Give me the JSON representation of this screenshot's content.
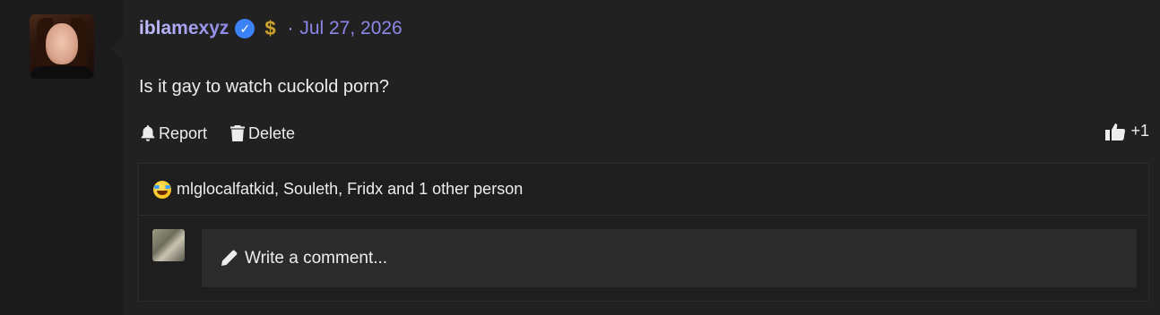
{
  "author": {
    "username": "iblamexyz",
    "badge_symbol": "$",
    "separator": "·",
    "date": "Jul 27, 2026"
  },
  "post": {
    "message": "Is it gay to watch cuckold porn?"
  },
  "actions": {
    "report_label": "Report",
    "delete_label": "Delete",
    "like_count": "+1"
  },
  "reactions": {
    "text": "mlglocalfatkid, Souleth, Fridx and 1 other person"
  },
  "comment": {
    "placeholder": "Write a comment..."
  },
  "colors": {
    "username": "#a9a6f5",
    "date": "#8b87e8",
    "verified": "#3b82f6",
    "dollar_badge": "#c9a12f",
    "background": "#212121"
  },
  "icons": {
    "verified": "verified-check-icon",
    "report": "bell-icon",
    "delete": "trash-icon",
    "like": "thumbs-up-icon",
    "reaction": "laughing-crying-emoji-icon",
    "comment": "pencil-icon"
  }
}
